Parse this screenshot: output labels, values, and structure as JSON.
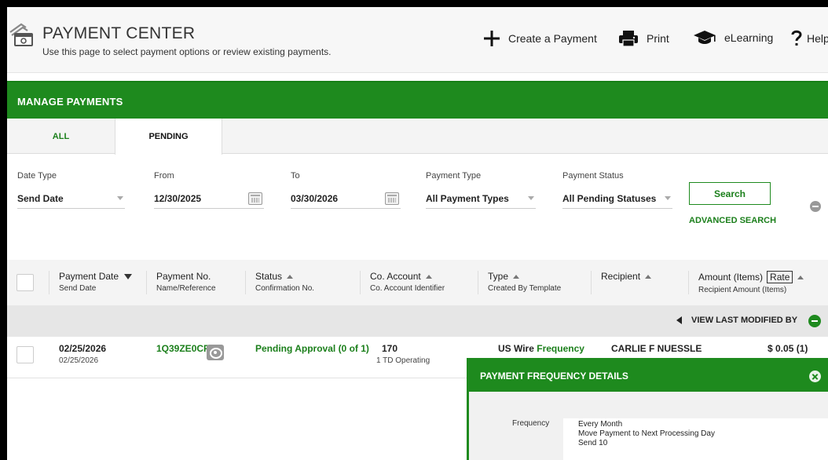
{
  "header": {
    "title": "PAYMENT CENTER",
    "subtitle": "Use this page to select payment options or review existing payments.",
    "actions": {
      "create": "Create a Payment",
      "print": "Print",
      "elearning": "eLearning",
      "help": "Help"
    },
    "icons": [
      "payment-center-icon",
      "plus-icon",
      "printer-icon",
      "graduation-cap-icon",
      "question-icon"
    ]
  },
  "manage": {
    "title": "MANAGE PAYMENTS"
  },
  "tabs": {
    "all": "ALL",
    "pending": "PENDING",
    "active": "PENDING"
  },
  "filters": {
    "date_type": {
      "label": "Date Type",
      "value": "Send Date"
    },
    "from": {
      "label": "From",
      "value": "12/30/2025"
    },
    "to": {
      "label": "To",
      "value": "03/30/2026"
    },
    "payment_type": {
      "label": "Payment Type",
      "value": "All Payment Types"
    },
    "payment_status": {
      "label": "Payment Status",
      "value": "All Pending Statuses"
    },
    "search": "Search",
    "advanced": "ADVANCED SEARCH"
  },
  "columns": [
    {
      "main": "Payment Date",
      "sub": "Send Date"
    },
    {
      "main": "Payment No.",
      "sub": "Name/Reference"
    },
    {
      "main": "Status",
      "sub": "Confirmation No."
    },
    {
      "main": "Co. Account",
      "sub": "Co. Account Identifier"
    },
    {
      "main": "Type",
      "sub": "Created By Template"
    },
    {
      "main": "Recipient",
      "sub": ""
    },
    {
      "main": "Amount (Items)",
      "rate": "Rate",
      "sub": "Recipient Amount (Items)"
    }
  ],
  "view_last_modified": "VIEW LAST MODIFIED BY",
  "rows": [
    {
      "payment_date": "02/25/2026",
      "send_date": "02/25/2026",
      "payment_no": "1Q39ZE0CFR",
      "status": "Pending Approval (0 of 1)",
      "co_account": "170",
      "co_account_id": "1 TD Operating",
      "type": "US Wire",
      "frequency_link": "Frequency",
      "recipient": "CARLIE F NUESSLE",
      "amount": "$ 0.05 (1)"
    }
  ],
  "popup": {
    "title": "PAYMENT FREQUENCY DETAILS",
    "label": "Frequency",
    "lines": [
      "Every Month",
      "Move Payment to Next Processing Day",
      "Send 10"
    ]
  },
  "colors": {
    "brand_green": "#1e8a1e",
    "link_green": "#1b7f1b"
  }
}
